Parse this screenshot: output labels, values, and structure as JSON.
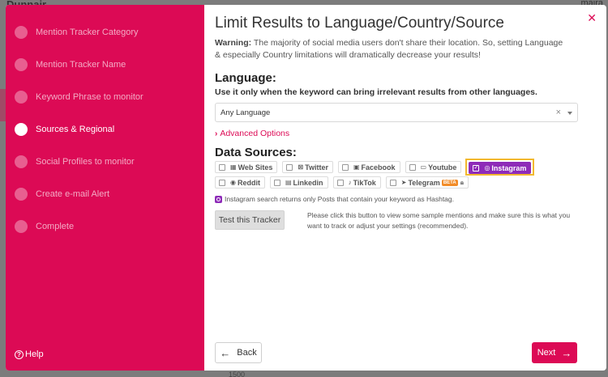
{
  "background": {
    "brand": "Dunnair",
    "user": "maira",
    "axis_value": "1500"
  },
  "sidebar": {
    "steps": [
      {
        "label": "Mention Tracker Category",
        "active": false
      },
      {
        "label": "Mention Tracker Name",
        "active": false
      },
      {
        "label": "Keyword Phrase to monitor",
        "active": false
      },
      {
        "label": "Sources & Regional",
        "active": true
      },
      {
        "label": "Social Profiles to monitor",
        "active": false
      },
      {
        "label": "Create e-mail Alert",
        "active": false
      },
      {
        "label": "Complete",
        "active": false
      }
    ],
    "help_label": "Help"
  },
  "main": {
    "title": "Limit Results to Language/Country/Source",
    "warning_prefix": "Warning:",
    "warning_text": " The majority of social media users don't share their location. So, setting Language & especially Country limitations will dramatically decrease your results!",
    "language_heading": "Language:",
    "language_hint": "Use it only when the keyword can bring irrelevant results from other languages.",
    "language_value": "Any Language",
    "advanced_label": "Advanced Options",
    "sources_heading": "Data Sources:",
    "sources": [
      {
        "label": "Web Sites",
        "checked": false
      },
      {
        "label": "Twitter",
        "checked": false
      },
      {
        "label": "Facebook",
        "checked": false
      },
      {
        "label": "Youtube",
        "checked": false
      },
      {
        "label": "Instagram",
        "checked": true
      },
      {
        "label": "Reddit",
        "checked": false
      },
      {
        "label": "Linkedin",
        "checked": false
      },
      {
        "label": "TikTok",
        "checked": false
      },
      {
        "label": "Telegram",
        "checked": false,
        "badge": "BETA"
      }
    ],
    "instagram_note": "Instagram search returns only Posts that contain your keyword as Hashtag.",
    "test_button": "Test this Tracker",
    "test_description": "Please click this button to view some sample mentions and make sure this is what you want to track or adjust your settings (recommended).",
    "back_button": "Back",
    "next_button": "Next"
  },
  "colors": {
    "brand": "#dc0a55",
    "instagram": "#8e2bb8",
    "highlight": "#f2b82e"
  }
}
